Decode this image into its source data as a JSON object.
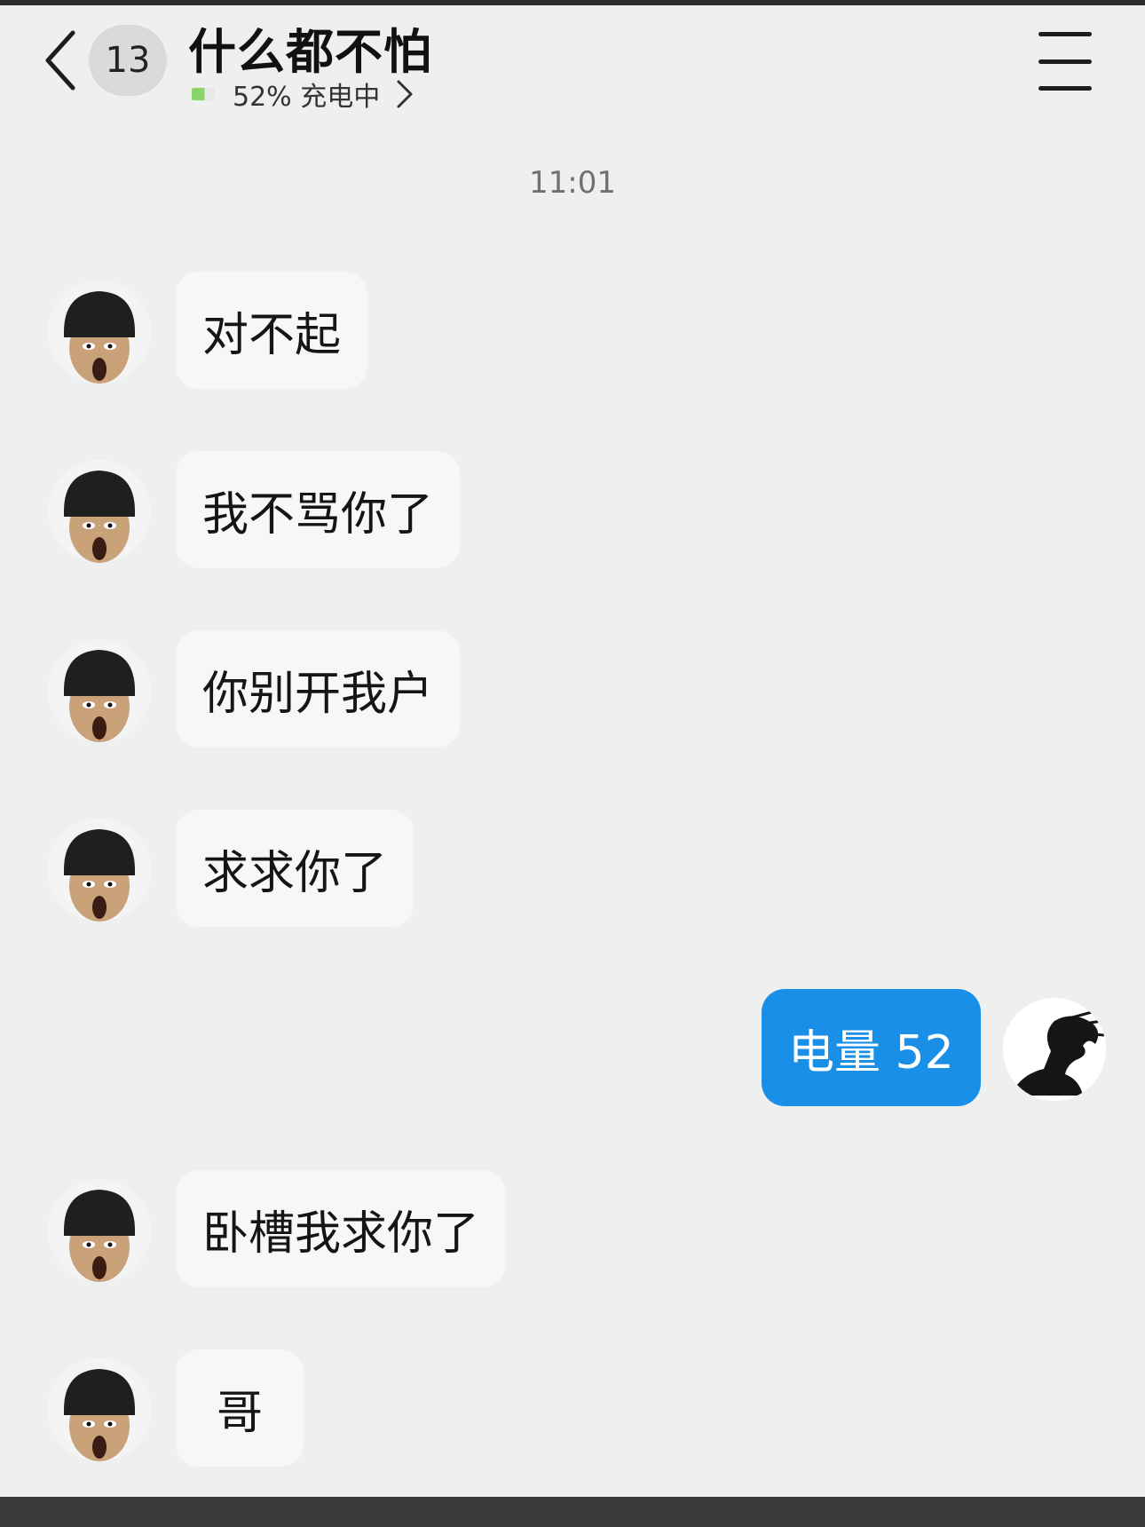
{
  "header": {
    "back_icon": "chevron-left-icon",
    "unread_count": "13",
    "title": "什么都不怕",
    "status_icon": "battery-icon",
    "status_text": "52% 充电中",
    "menu_icon": "hamburger-menu-icon"
  },
  "chat": {
    "timestamp": "11:01",
    "messages": [
      {
        "side": "left",
        "text": "对不起"
      },
      {
        "side": "left",
        "text": "我不骂你了"
      },
      {
        "side": "left",
        "text": "你别开我户"
      },
      {
        "side": "left",
        "text": "求求你了"
      },
      {
        "side": "right",
        "text": "电量 52"
      },
      {
        "side": "left",
        "text": "卧槽我求你了"
      },
      {
        "side": "left",
        "text": "哥"
      }
    ]
  },
  "colors": {
    "background": "#eef0ef",
    "received_bubble": "#f7f7f7",
    "sent_bubble": "#1a8fe8"
  }
}
